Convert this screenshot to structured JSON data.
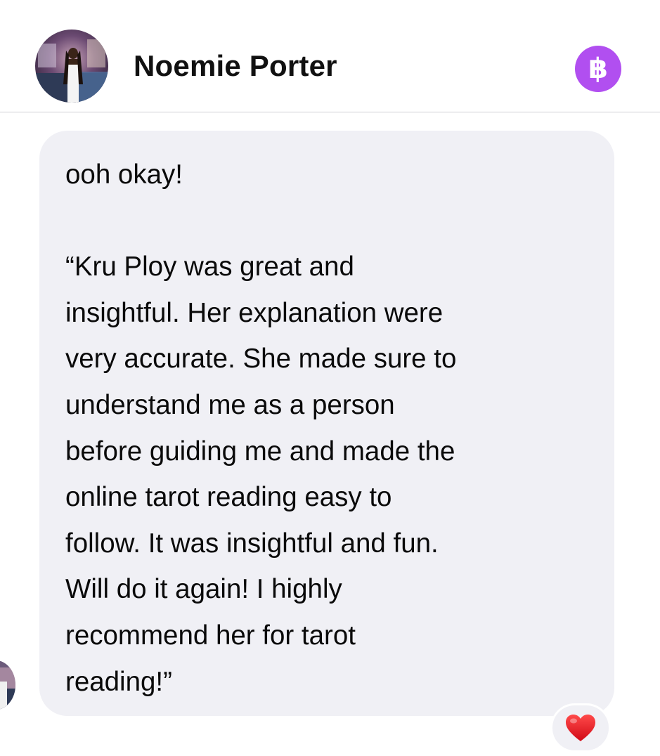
{
  "header": {
    "contact_name": "Noemie Porter",
    "badge_symbol": "฿",
    "badge_color": "#b14ff0"
  },
  "message": {
    "lines": [
      "ooh okay!",
      "",
      "“Kru Ploy was great and",
      "insightful. Her explanation were",
      "very accurate. She made sure to",
      "understand me as a person",
      "before guiding me and made the",
      "online tarot reading easy to",
      "follow. It was insightful and fun.",
      "Will do it again! I highly",
      "recommend her for tarot",
      "reading!”"
    ],
    "bubble_color": "#f0f0f5",
    "reaction_icon": "red-heart-icon",
    "reaction_color": "#e0101e"
  }
}
